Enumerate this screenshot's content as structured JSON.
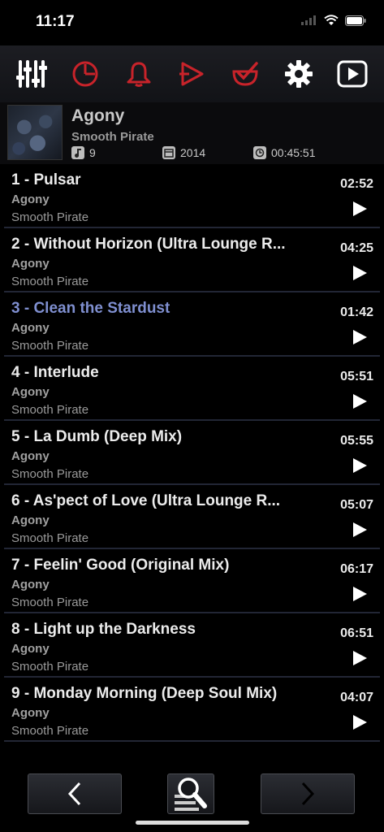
{
  "status": {
    "time": "11:17"
  },
  "toolbar": {
    "items": [
      {
        "icon": "equalizer-icon",
        "color": "#ffffff"
      },
      {
        "icon": "timer-icon",
        "color": "#c8232a"
      },
      {
        "icon": "alarm-bell-icon",
        "color": "#c8232a"
      },
      {
        "icon": "playlist-play-icon",
        "color": "#c8232a"
      },
      {
        "icon": "favorite-check-icon",
        "color": "#c8232a"
      },
      {
        "icon": "gear-icon",
        "color": "#ffffff"
      },
      {
        "icon": "now-playing-icon",
        "color": "#ffffff"
      }
    ]
  },
  "album": {
    "title": "Agony",
    "artist": "Smooth Pirate",
    "track_count": "9",
    "year": "2014",
    "total_duration": "00:45:51"
  },
  "tracks": [
    {
      "title": "1 - Pulsar",
      "album": "Agony",
      "artist": "Smooth Pirate",
      "duration": "02:52",
      "active": false
    },
    {
      "title": "2 - Without Horizon (Ultra Lounge R...",
      "album": "Agony",
      "artist": "Smooth Pirate",
      "duration": "04:25",
      "active": false
    },
    {
      "title": "3 - Clean the Stardust",
      "album": "Agony",
      "artist": "Smooth Pirate",
      "duration": "01:42",
      "active": true
    },
    {
      "title": "4 - Interlude",
      "album": "Agony",
      "artist": "Smooth Pirate",
      "duration": "05:51",
      "active": false
    },
    {
      "title": "5 - La Dumb (Deep Mix)",
      "album": "Agony",
      "artist": "Smooth Pirate",
      "duration": "05:55",
      "active": false
    },
    {
      "title": "6 - As'pect of Love  (Ultra Lounge R...",
      "album": "Agony",
      "artist": "Smooth Pirate",
      "duration": "05:07",
      "active": false
    },
    {
      "title": "7 - Feelin' Good  (Original Mix)",
      "album": "Agony",
      "artist": "Smooth Pirate",
      "duration": "06:17",
      "active": false
    },
    {
      "title": "8 - Light up the Darkness",
      "album": "Agony",
      "artist": "Smooth Pirate",
      "duration": "06:51",
      "active": false
    },
    {
      "title": "9 - Monday Morning (Deep Soul Mix)",
      "album": "Agony",
      "artist": "Smooth Pirate",
      "duration": "04:07",
      "active": false
    }
  ],
  "colors": {
    "accent_red": "#c8232a",
    "active_track": "#7f8fd0",
    "divider": "#222635"
  }
}
